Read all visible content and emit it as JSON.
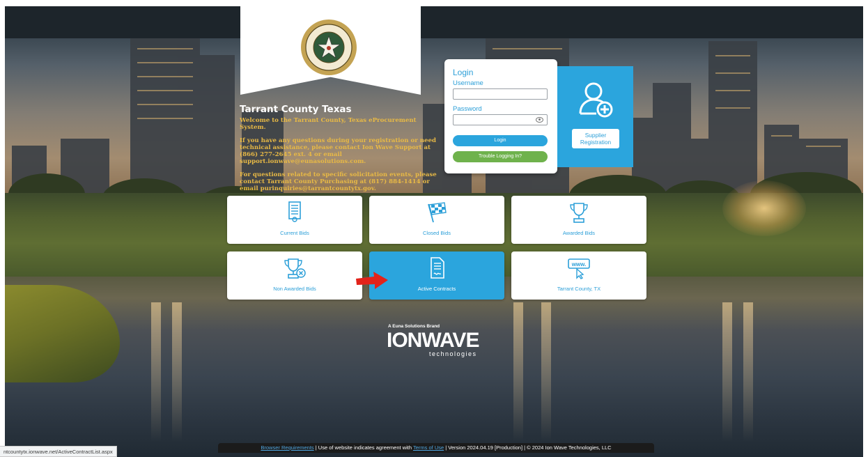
{
  "header": {
    "org_title": "Tarrant County Texas",
    "seal_alt_text": "TARRANT COUNTY TEXAS"
  },
  "welcome": {
    "para1": "Welcome to the Tarrant County, Texas eProcurement System.",
    "para2": "If you have any questions during your registration or need technical assistance, please contact Ion Wave Support at (866) 277-2645 ext. 4 or email support.ionwave@eunasolutions.com.",
    "para3": "For questions related to specific solicitation events, please contact Tarrant County Purchasing at (817) 884-1414 or email purinquiries@tarrantcountytx.gov."
  },
  "login": {
    "heading": "Login",
    "username_label": "Username",
    "username_value": "",
    "password_label": "Password",
    "password_value": "",
    "login_button": "Login",
    "trouble_button": "Trouble Logging In?"
  },
  "supplier": {
    "button_line1": "Supplier",
    "button_line2": "Registration",
    "icon": "add-user-icon"
  },
  "tiles": [
    {
      "label": "Current Bids",
      "icon": "certificate-document-icon"
    },
    {
      "label": "Closed Bids",
      "icon": "checkered-flag-icon"
    },
    {
      "label": "Awarded Bids",
      "icon": "trophy-icon"
    },
    {
      "label": "Non Awarded Bids",
      "icon": "trophy-x-icon"
    },
    {
      "label": "Active Contracts",
      "icon": "signed-document-icon"
    },
    {
      "label": "Tarrant County, TX",
      "icon": "www-cursor-icon"
    }
  ],
  "brand": {
    "tagline": "A Euna Solutions Brand",
    "wordmark": "IONWAVE",
    "sub": "technologies"
  },
  "footer": {
    "browser_link": "Browser Requirements",
    "text1": " | Use of website indicates agreement with ",
    "terms_link": "Terms of Use",
    "text2": " | Version 2024.04.19 [Production] | © 2024 Ion Wave Technologies, LLC"
  },
  "status_url": "ntcountytx.ionwave.net/ActiveContractList.aspx",
  "colors": {
    "accent_blue": "#2ba5dd",
    "trouble_green": "#6fb24c",
    "welcome_gold": "#e8b945",
    "arrow_red": "#e2231a"
  }
}
